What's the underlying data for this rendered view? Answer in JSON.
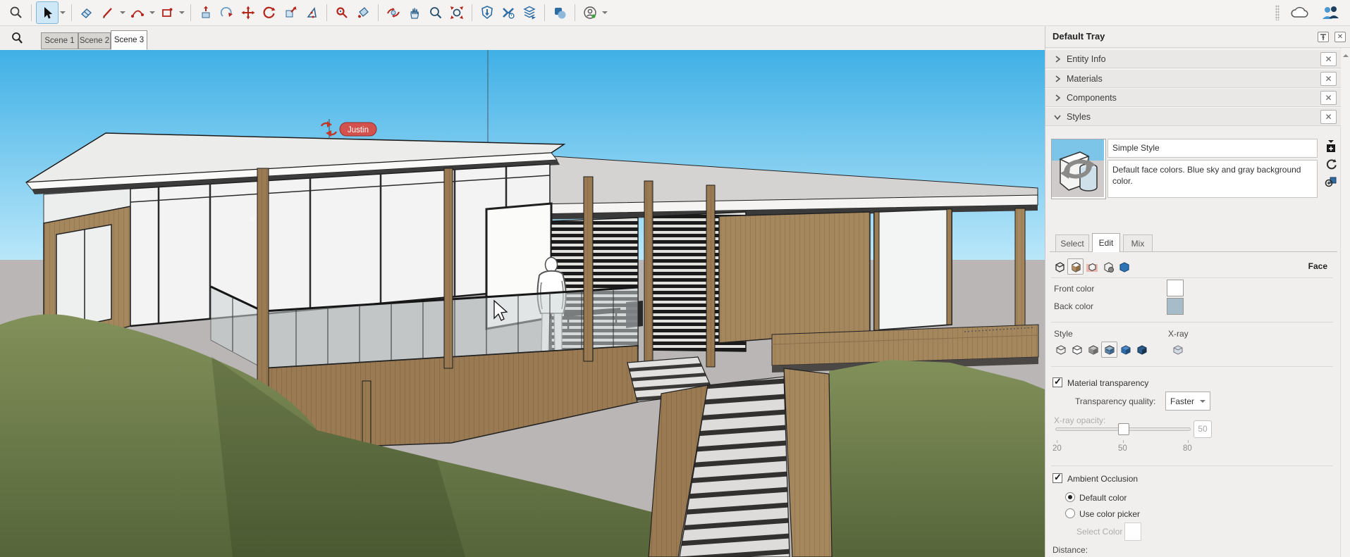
{
  "toolbar": {
    "tools": [
      "search",
      "select",
      "eraser",
      "line",
      "arcs",
      "rectangle",
      "push-pull",
      "follow-me",
      "move",
      "rotate",
      "scale",
      "offset",
      "tape-measure",
      "paint-bucket",
      "orbit",
      "pan",
      "zoom",
      "zoom-extents",
      "connect-shield",
      "solid-tools",
      "layer-stack",
      "shapes",
      "account"
    ]
  },
  "scene_tabs": {
    "tabs": [
      {
        "label": "Scene 1"
      },
      {
        "label": "Scene 2"
      },
      {
        "label": "Scene 3"
      }
    ],
    "active_tab": "Scene 3"
  },
  "viewport": {
    "presence_tag_label": "Justin",
    "colors": {
      "sky_top": "#3fb0e6",
      "sky_bottom": "#bfe9fa",
      "background_gray": "#bab6b5",
      "grass": "#6b7a47",
      "wood": "#a5875e"
    }
  },
  "tray": {
    "title": "Default Tray",
    "sections": [
      {
        "label": "Entity Info"
      },
      {
        "label": "Materials"
      },
      {
        "label": "Components"
      },
      {
        "label": "Styles"
      }
    ],
    "expanded_section": "Styles",
    "styles": {
      "name_value": "Simple Style",
      "description": "Default face colors. Blue sky and gray background color.",
      "tabs": [
        {
          "label": "Select"
        },
        {
          "label": "Edit"
        },
        {
          "label": "Mix"
        }
      ],
      "active_tab": "Edit",
      "pane_label": "Face",
      "front_color_label": "Front color",
      "back_color_label": "Back color",
      "front_color": "#ffffff",
      "back_color": "#a7bcc9",
      "style_label": "Style",
      "xray_label": "X-ray",
      "material_transparency_label": "Material transparency",
      "material_transparency_checked": true,
      "transparency_quality_label": "Transparency quality:",
      "transparency_quality_value": "Faster",
      "xray_opacity_label": "X-ray opacity:",
      "xray_opacity_value": "50",
      "slider_tick_labels": [
        "20",
        "50",
        "80"
      ],
      "ambient_occlusion_label": "Ambient Occlusion",
      "ambient_occlusion_checked": true,
      "default_color_label": "Default color",
      "use_color_picker_label": "Use color picker",
      "ao_selected_option": "Default color",
      "select_color_label": "Select Color",
      "distance_label": "Distance:"
    }
  }
}
